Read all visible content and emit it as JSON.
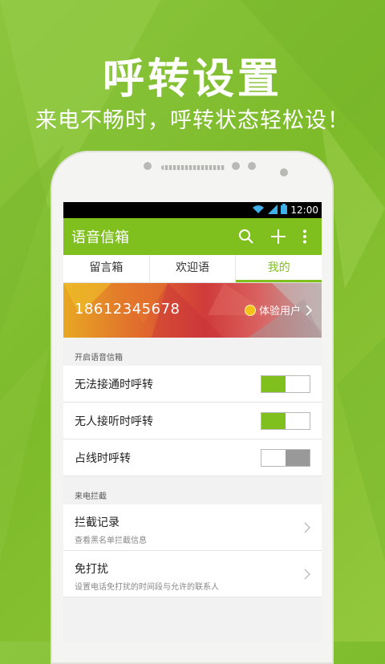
{
  "promo": {
    "title": "呼转设置",
    "subtitle": "来电不畅时，呼转状态轻松设！"
  },
  "status_bar": {
    "time": "12:00",
    "icons": [
      "wifi-icon",
      "signal-icon",
      "battery-icon"
    ]
  },
  "app_bar": {
    "title": "语音信箱",
    "actions": [
      "search-icon",
      "add-icon",
      "more-vert-icon"
    ]
  },
  "tabs": [
    {
      "label": "留言箱",
      "selected": false
    },
    {
      "label": "欢迎语",
      "selected": false
    },
    {
      "label": "我的",
      "selected": true
    }
  ],
  "account": {
    "phone_number": "18612345678",
    "user_type": "体验用户"
  },
  "voicemail_section": {
    "header": "开启语音信箱",
    "items": [
      {
        "label": "无法接通时呼转",
        "enabled": true
      },
      {
        "label": "无人接听时呼转",
        "enabled": true
      },
      {
        "label": "占线时呼转",
        "enabled": false
      }
    ]
  },
  "block_section": {
    "header": "来电拦截",
    "items": [
      {
        "label": "拦截记录",
        "desc": "查看黑名单拦截信息"
      },
      {
        "label": "免打扰",
        "desc": "设置电话免打扰的时间段与允许的联系人"
      }
    ]
  },
  "colors": {
    "accent": "#7fc01e",
    "background": "#8cc63f"
  }
}
